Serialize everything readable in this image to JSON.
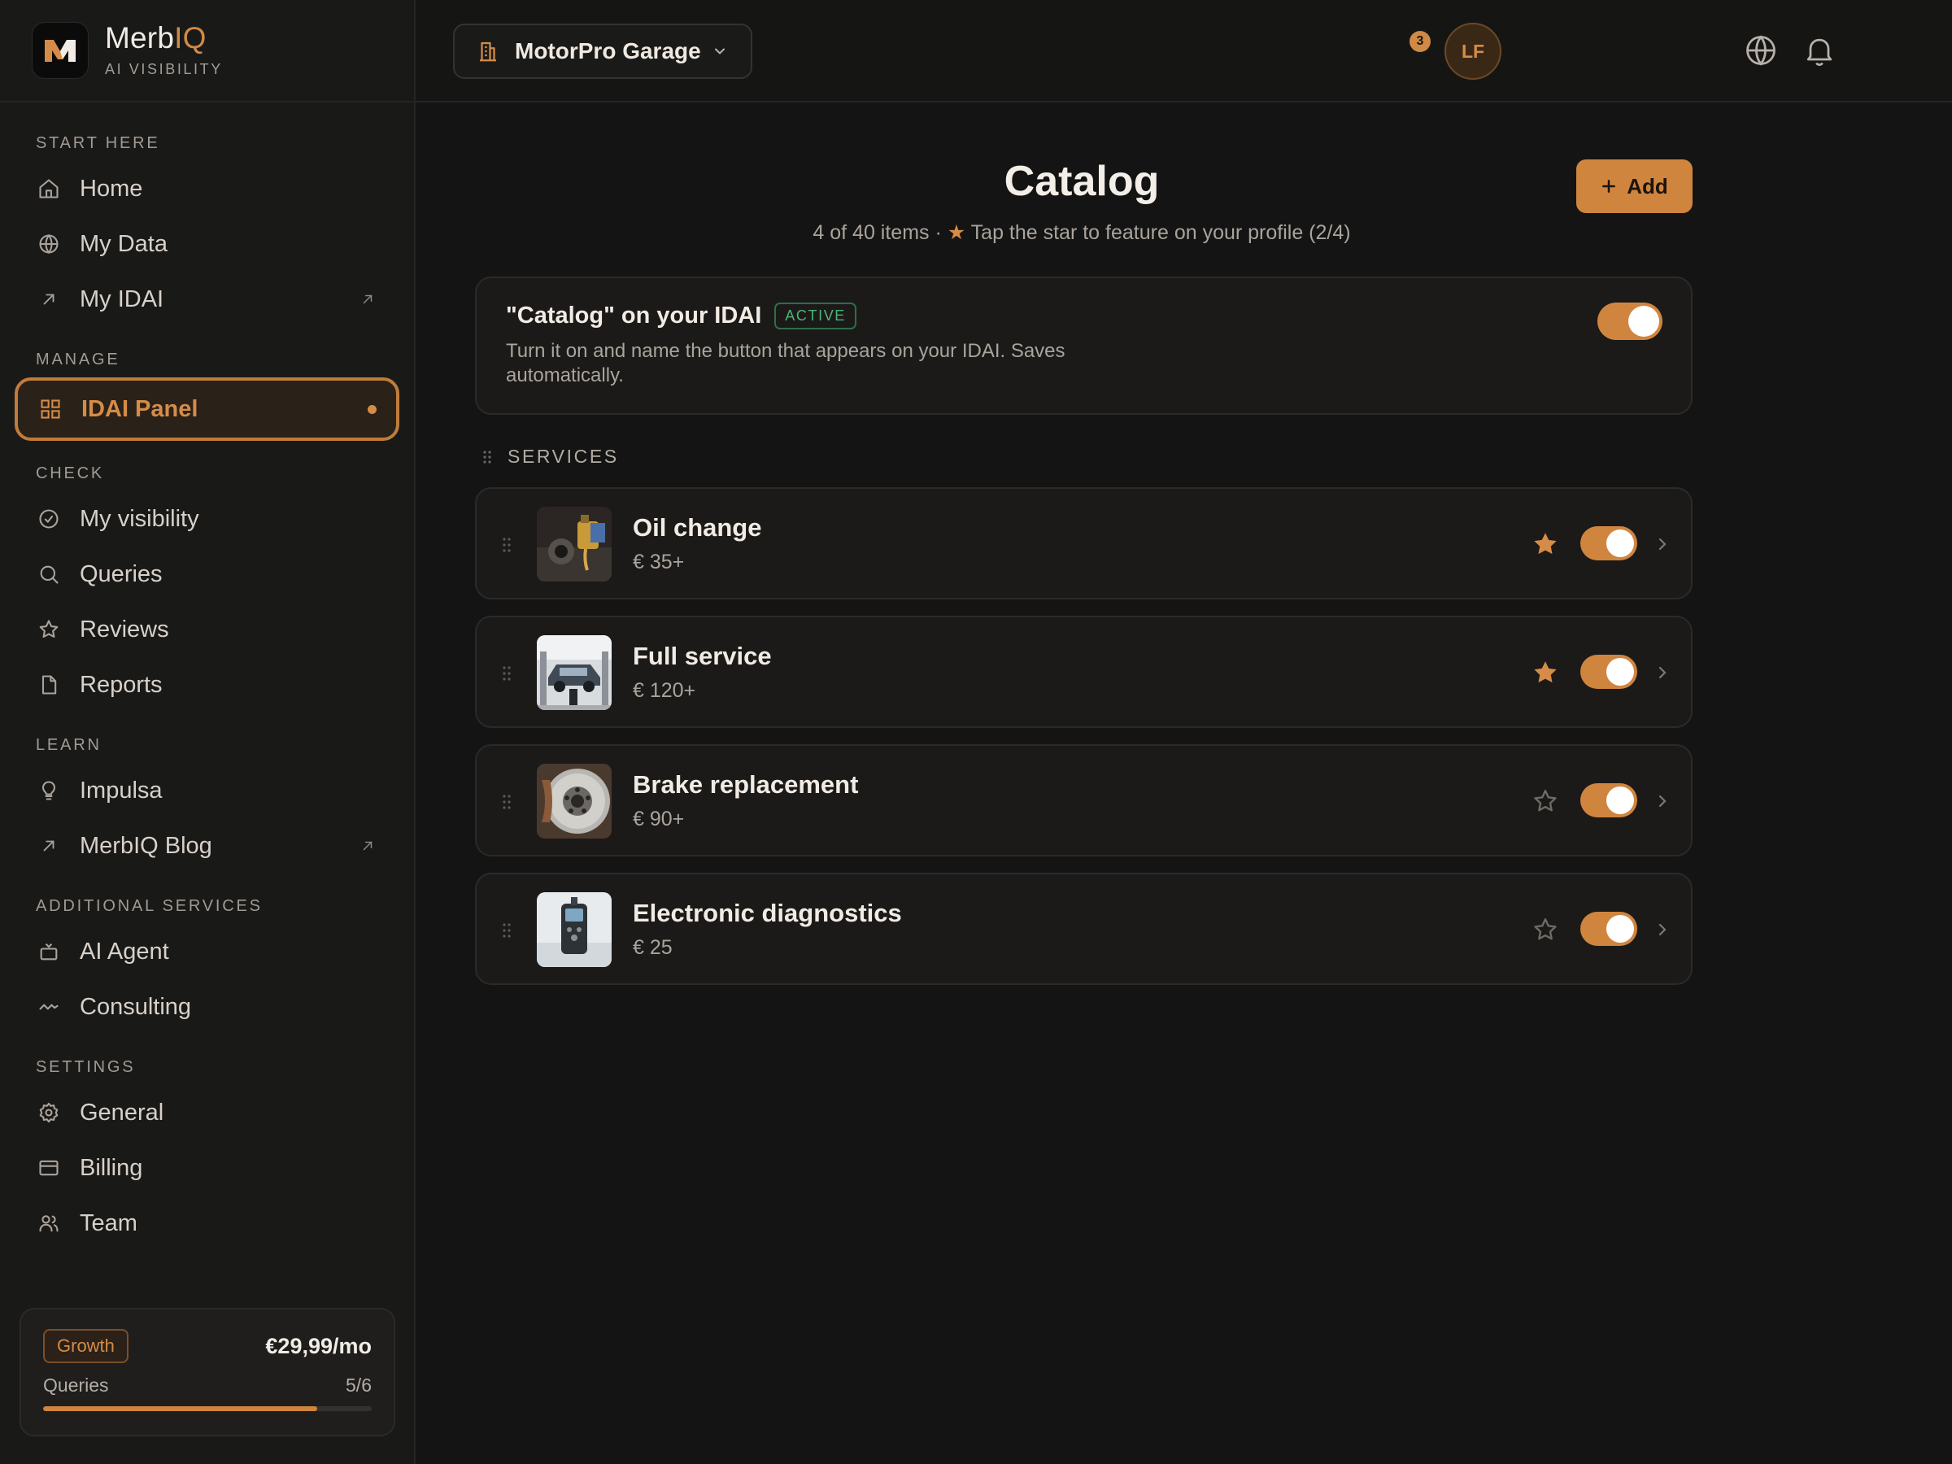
{
  "brand": {
    "name_main": "Merb",
    "name_accent": "IQ",
    "subtitle": "AI VISIBILITY"
  },
  "sidebar": {
    "sections": [
      {
        "title": "START HERE",
        "items": [
          {
            "label": "Home",
            "icon": "home-icon"
          },
          {
            "label": "My Data",
            "icon": "globe-icon"
          },
          {
            "label": "My IDAI",
            "icon": "arrow-up-right-icon",
            "external": true
          }
        ]
      },
      {
        "title": "MANAGE",
        "items": [
          {
            "label": "IDAI Panel",
            "icon": "grid-icon",
            "active": true
          }
        ]
      },
      {
        "title": "CHECK",
        "items": [
          {
            "label": "My visibility",
            "icon": "gauge-icon"
          },
          {
            "label": "Queries",
            "icon": "search-icon"
          },
          {
            "label": "Reviews",
            "icon": "star-icon"
          },
          {
            "label": "Reports",
            "icon": "document-icon"
          }
        ]
      },
      {
        "title": "LEARN",
        "items": [
          {
            "label": "Impulsa",
            "icon": "lightbulb-icon"
          },
          {
            "label": "MerbIQ Blog",
            "icon": "arrow-up-right-icon",
            "external": true
          }
        ]
      },
      {
        "title": "ADDITIONAL SERVICES",
        "items": [
          {
            "label": "AI Agent",
            "icon": "bot-icon"
          },
          {
            "label": "Consulting",
            "icon": "activity-icon"
          }
        ]
      },
      {
        "title": "SETTINGS",
        "items": [
          {
            "label": "General",
            "icon": "gear-icon"
          },
          {
            "label": "Billing",
            "icon": "credit-card-icon"
          },
          {
            "label": "Team",
            "icon": "users-icon"
          }
        ]
      }
    ]
  },
  "plan": {
    "badge": "Growth",
    "price": "€29,99/mo",
    "usage_label": "Queries",
    "usage_value": "5/6",
    "usage_fraction": 0.8333
  },
  "topbar": {
    "business_name": "MotorPro Garage",
    "notifications_count": "3",
    "avatar_initials": "LF"
  },
  "main": {
    "title": "Catalog",
    "subtitle_prefix": "4 of 40 items · ",
    "subtitle_star": "★",
    "subtitle_suffix": " Tap the star to feature on your profile (2/4)",
    "add_button": "Add",
    "idai_card": {
      "title": "\"Catalog\" on your IDAI",
      "badge": "ACTIVE",
      "description": "Turn it on and name the button that appears on your IDAI. Saves automatically.",
      "enabled": true
    },
    "services_heading": "SERVICES",
    "services": [
      {
        "name": "Oil change",
        "price": "€ 35+",
        "featured": true,
        "enabled": true,
        "image": "oil-change-photo"
      },
      {
        "name": "Full service",
        "price": "€ 120+",
        "featured": true,
        "enabled": true,
        "image": "car-lift-photo"
      },
      {
        "name": "Brake replacement",
        "price": "€ 90+",
        "featured": false,
        "enabled": true,
        "image": "brake-disc-photo"
      },
      {
        "name": "Electronic diagnostics",
        "price": "€ 25",
        "featured": false,
        "enabled": true,
        "image": "diagnostic-scanner-photo"
      }
    ]
  },
  "colors": {
    "accent": "#d0853f",
    "background": "#141414",
    "sidebar": "#191918",
    "active_green": "#4fb477"
  }
}
